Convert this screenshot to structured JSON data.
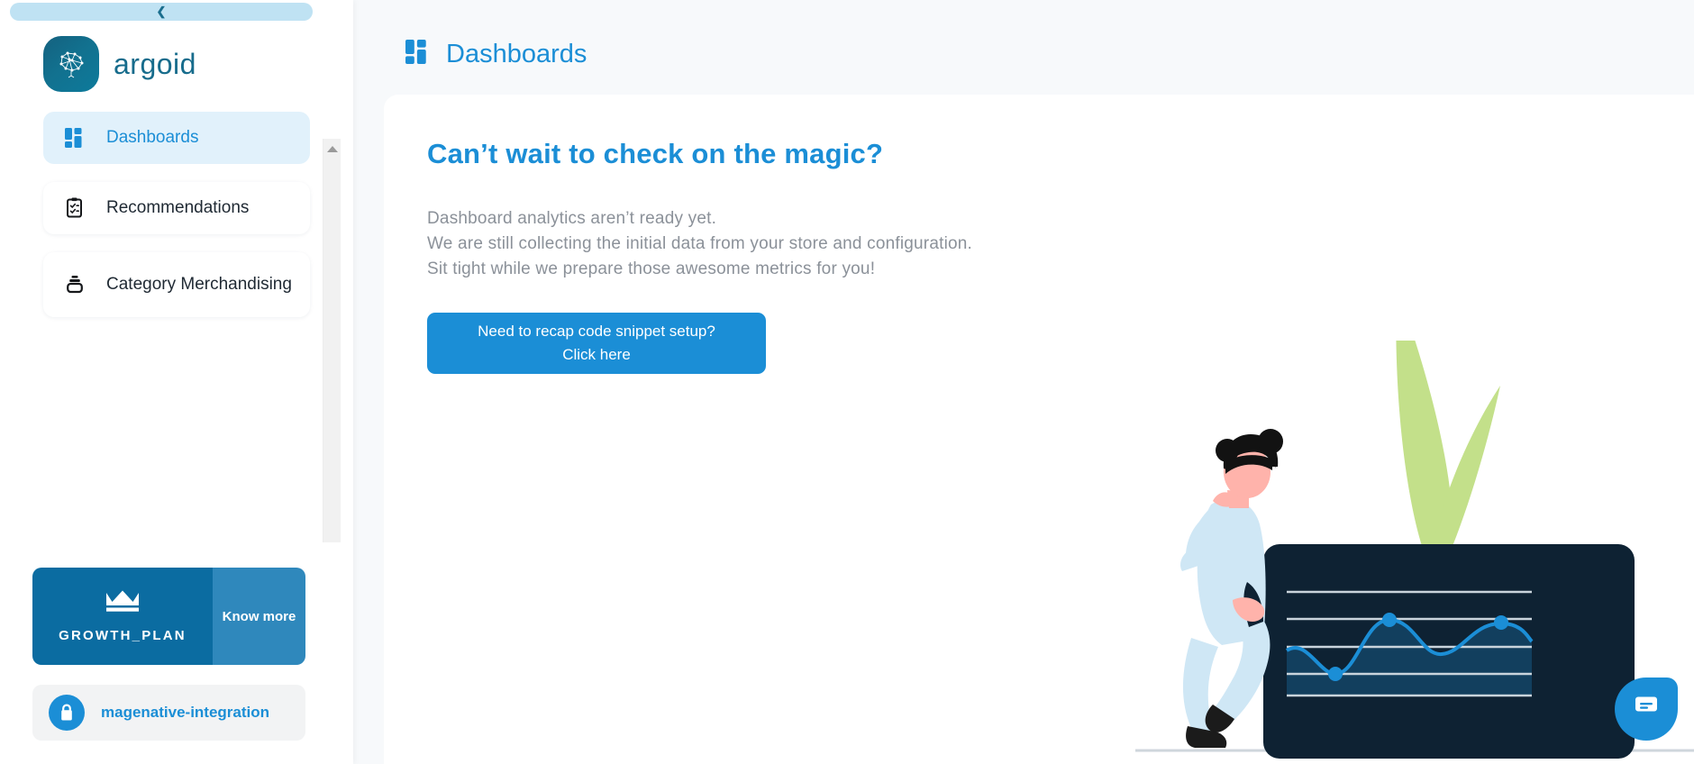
{
  "sidebar": {
    "collapse_icon": "chevron-left-icon",
    "brand": {
      "name": "argoid",
      "logo_icon": "brain-network-icon",
      "logo_color": "#14617f"
    },
    "nav_items": [
      {
        "label": "Dashboards",
        "icon": "dashboard-grid-icon",
        "active": true
      },
      {
        "label": "Recommendations",
        "icon": "clipboard-check-icon",
        "active": false
      },
      {
        "label": "Category Merchandising",
        "icon": "layers-stack-icon",
        "active": false
      }
    ],
    "plan": {
      "name": "GROWTH_PLAN",
      "icon": "crown-icon",
      "action_label": "Know more",
      "left_color": "#0b6ca1",
      "right_color": "#2f88bc"
    },
    "integration": {
      "label": "magenative-integration",
      "icon": "shopping-bag-icon",
      "color": "#1b8ed6"
    }
  },
  "header": {
    "title": "Dashboards",
    "icon": "dashboard-grid-icon",
    "accent": "#1b8ed6"
  },
  "main": {
    "hero_title": "Can’t wait to check on the magic?",
    "body_lines": [
      "Dashboard analytics aren’t ready yet.",
      "We are still collecting the initial data from your store and configuration.",
      "Sit tight while we prepare those awesome metrics for you!"
    ],
    "cta": {
      "line1": "Need to recap code snippet setup?",
      "line2": "Click here",
      "color": "#1b8ed6"
    }
  },
  "illustration": {
    "name": "analytics-dashboard-illustration",
    "plant_color": "#c3e08a",
    "screen_color": "#0e2233",
    "line_color": "#1b8ed6",
    "skin_color": "#ffb3ab",
    "clothing_color": "#cfe7f5",
    "hair_color": "#121212"
  },
  "chat": {
    "icon": "chat-message-icon",
    "color": "#1b8ed6"
  }
}
